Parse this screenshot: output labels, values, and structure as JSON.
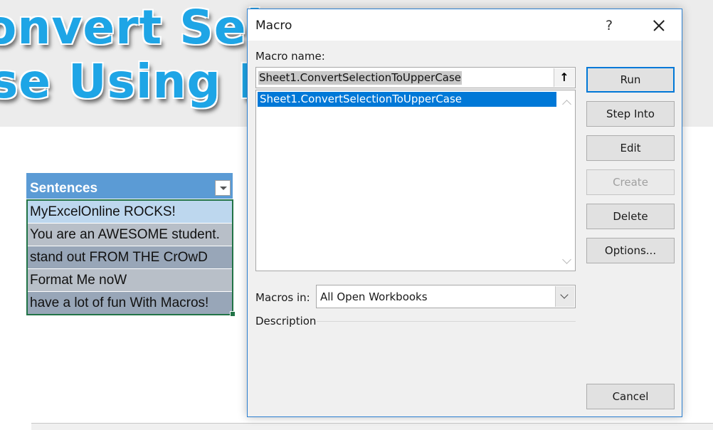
{
  "banner": {
    "line1": "onvert Selec",
    "line2": "se Using Ma"
  },
  "sheet": {
    "table_header": "Sentences",
    "rows": [
      "MyExcelOnline ROCKS!",
      "You are an AWESOME student.",
      "stand out FROM THE CrOwD",
      "Format Me noW",
      "have a lot of fun With Macros!"
    ]
  },
  "dialog": {
    "title": "Macro",
    "help_label": "?",
    "macro_name_label": "Macro name:",
    "macro_name_value": "Sheet1.ConvertSelectionToUpperCase",
    "upload_icon": "↑",
    "macro_list": [
      "Sheet1.ConvertSelectionToUpperCase"
    ],
    "macros_in_label": "Macros in:",
    "macros_in_value": "All Open Workbooks",
    "description_label": "Description",
    "buttons": {
      "run": "Run",
      "step_into": "Step Into",
      "edit": "Edit",
      "create": "Create",
      "delete": "Delete",
      "options": "Options...",
      "cancel": "Cancel"
    }
  },
  "colors": {
    "accent": "#0078d7",
    "table_header": "#5b9bd5",
    "banner_text": "#1ea5e6",
    "selection_border": "#217346"
  }
}
